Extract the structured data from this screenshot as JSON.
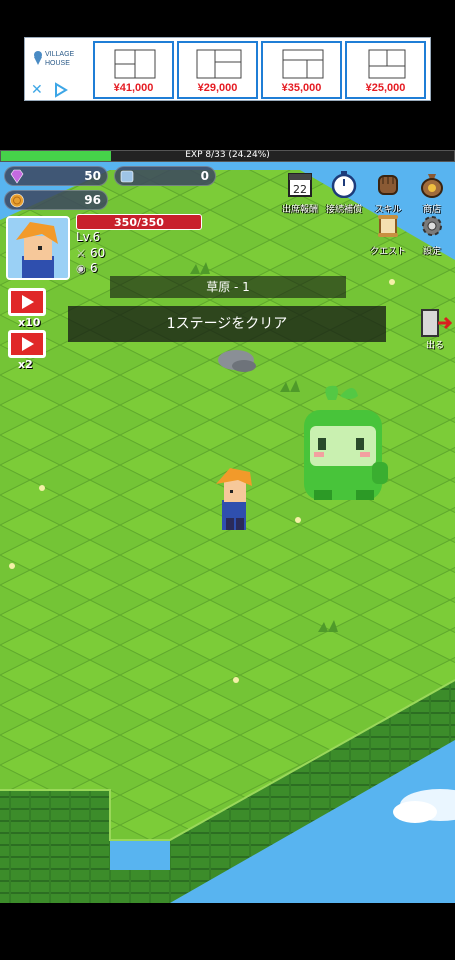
{
  "ad": {
    "brand_line1": "VILLAGE",
    "brand_line2": "HOUSE",
    "close_glyph": "✕",
    "listings": [
      {
        "price": "¥41,000"
      },
      {
        "price": "¥29,000"
      },
      {
        "price": "¥35,000"
      },
      {
        "price": "¥25,000"
      }
    ]
  },
  "hud": {
    "exp_text": "EXP 8/33 (24.24%)",
    "exp_progress": 0.2424,
    "gems": "50",
    "crystals": "0",
    "coins": "96",
    "hp_text": "350/350",
    "level": "Lv.6",
    "attack": "60",
    "defense": "6",
    "video_gem_multiplier": "x10",
    "video_speed_multiplier": "x2"
  },
  "menu": {
    "attendance_day": "22",
    "attendance_label": "出席報酬",
    "idle_label": "接続補償",
    "skill_label": "スキル",
    "shop_label": "商店",
    "quest_label": "クエスト",
    "settings_label": "設定",
    "exit_label": "出る"
  },
  "stage": {
    "name": "草原 - 1",
    "message": "1ステージをクリア"
  },
  "colors": {
    "exp_fill": "#46d24a",
    "hp_fill": "#c8202c",
    "grass_light": "#7ccc38",
    "grass_dark": "#62b02c",
    "sky": "#58b4f0"
  }
}
